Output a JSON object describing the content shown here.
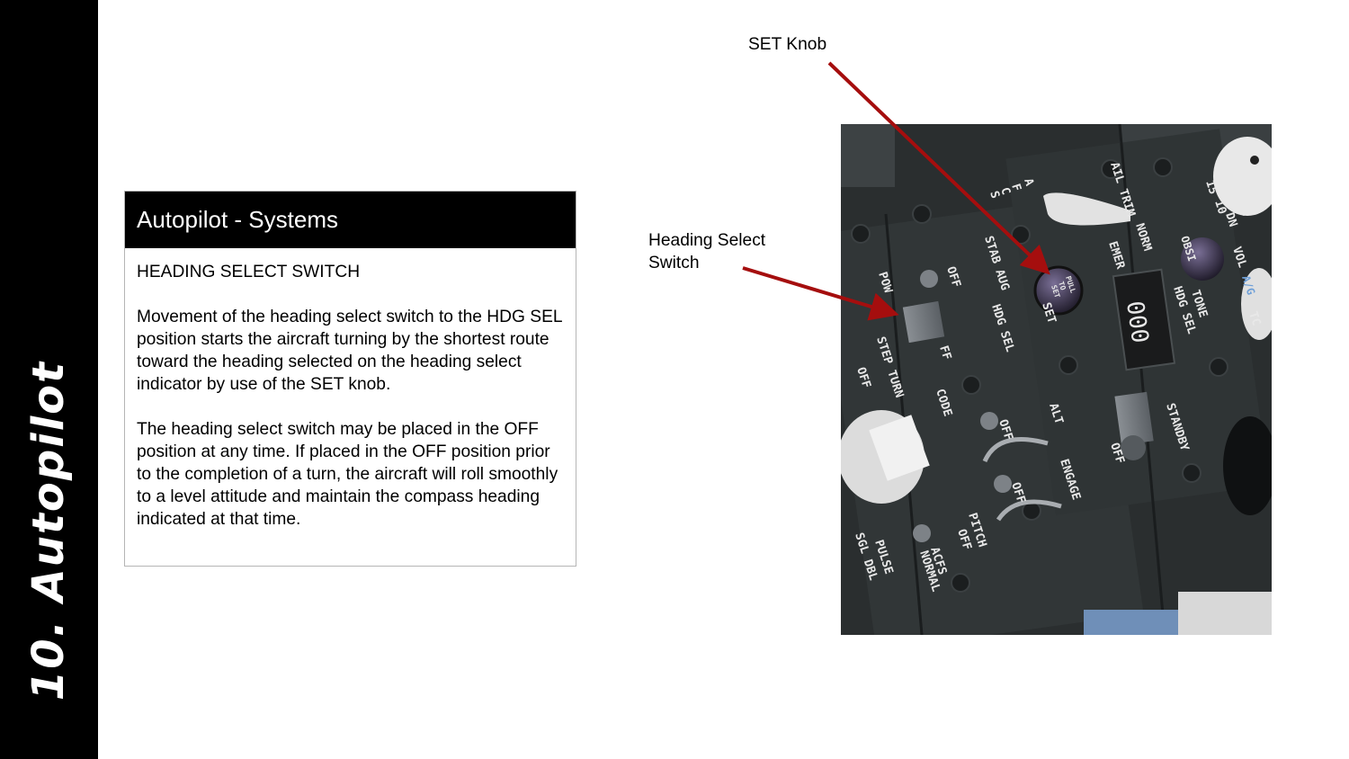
{
  "sidebar": {
    "title": "10. Autopilot"
  },
  "card": {
    "header": "Autopilot - Systems",
    "paragraphs": [
      "HEADING SELECT SWITCH",
      "Movement of the heading select switch to the HDG SEL position starts the aircraft turning by the shortest route toward the heading selected on the heading select indicator by use of the SET knob.",
      "The heading select switch may be placed in the OFF position at any time. If placed in the OFF position prior to the completion of a turn, the aircraft will roll smoothly to a level attitude and maintain the compass heading indicated at that time."
    ]
  },
  "callouts": {
    "set_knob": "SET Knob",
    "heading_select_line1": "Heading Select",
    "heading_select_line2": "Switch"
  },
  "panel_labels": {
    "afcs_letters": [
      "A",
      "F",
      "C",
      "S"
    ],
    "ail_trim": "AIL TRIM",
    "norm": "NORM",
    "emer": "EMER",
    "obsi": "OBSI",
    "hdg_sel_top": "HDG SEL",
    "display": "000",
    "pull_to_set": [
      "PULL",
      "TO",
      "SET"
    ],
    "set": "SET",
    "stab_aug": "STAB AUG",
    "off": "OFF",
    "hdg_sel": "HDG SEL",
    "off_cut": "FF",
    "pow": "POW",
    "step_turn": "STEP TURN",
    "code": "CODE",
    "alt": "ALT",
    "engage": "ENGAGE",
    "standby": "STANDBY",
    "pitch": "PITCH",
    "acfs": "ACFS",
    "normal": "NORMAL",
    "pulse": "PULSE",
    "sgl_dbl": "SGL DBL",
    "tone": "TONE",
    "vol": "VOL",
    "dn": "DN",
    "ten": "10",
    "fifteen": "15",
    "five": "5",
    "ag": "A/G",
    "tc": "TC"
  },
  "colors": {
    "arrow": "#a50e0e",
    "panel": "#2b2f30",
    "sidebar": "#000000"
  }
}
